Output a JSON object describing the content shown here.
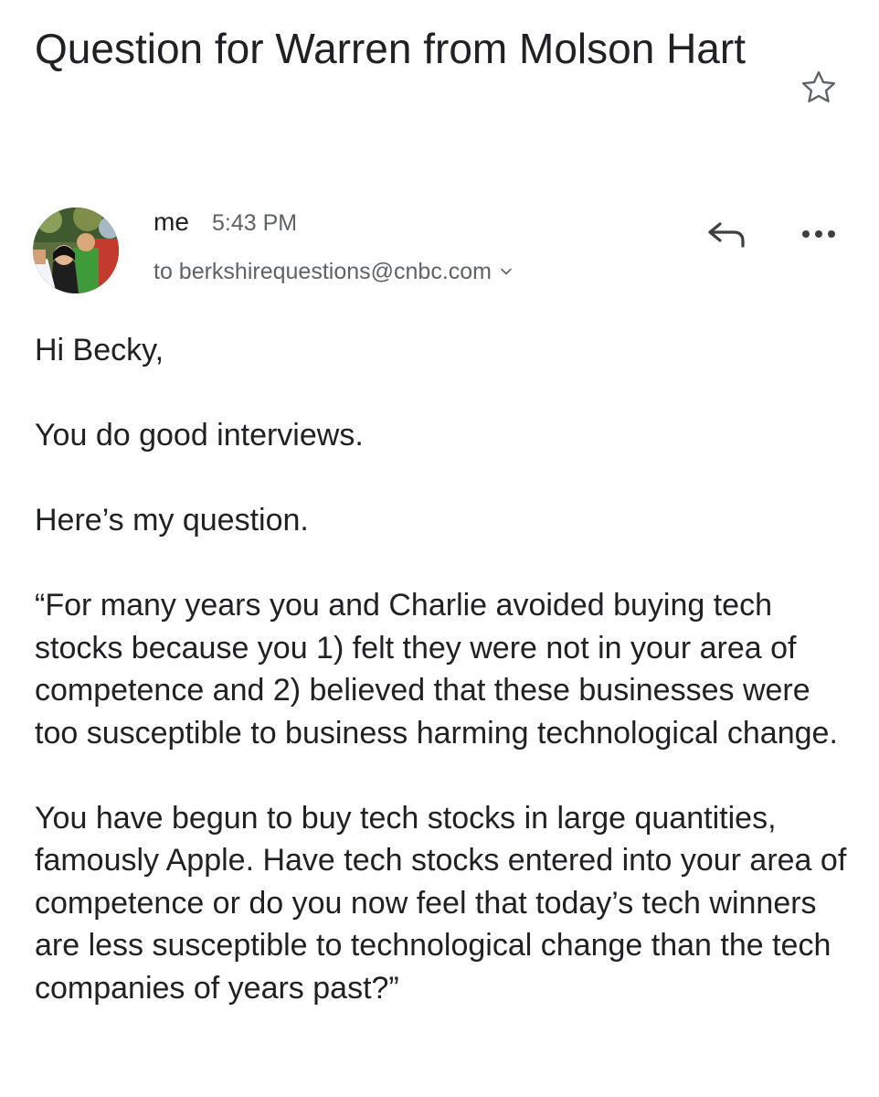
{
  "email": {
    "subject": "Question for Warren from Molson Hart",
    "sender": {
      "name": "me",
      "time": "5:43 PM",
      "recipient": "to berkshirequestions@cnbc.com"
    },
    "icons": {
      "star": "star-outline-icon",
      "reply": "reply-arrow-icon",
      "more": "more-horizontal-icon",
      "expand": "chevron-down-icon"
    },
    "body": {
      "greeting": "Hi Becky,",
      "p1": "You do good interviews.",
      "p2": "Here’s my question.",
      "p3": "“For many years you and Charlie avoided buying tech stocks because you 1) felt they were not in your area of competence  and 2) believed that these businesses were too susceptible to business harming technological change.",
      "p4": "You have begun to buy tech stocks in large quantities, famously Apple. Have tech stocks entered into your area of competence or do you now feel that today’s tech winners are less susceptible to technological change than the tech companies of years past?”"
    }
  }
}
